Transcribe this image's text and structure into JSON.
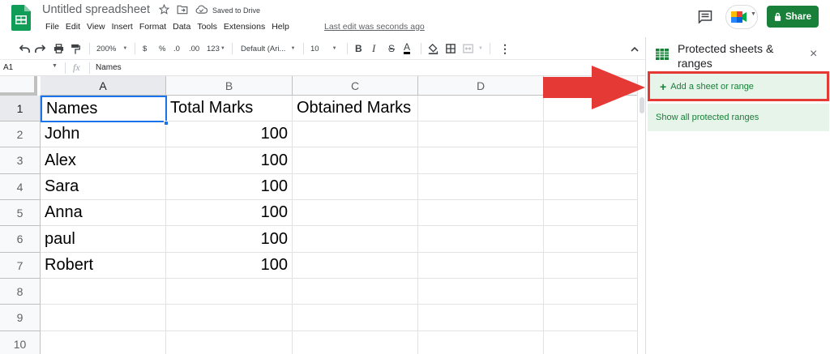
{
  "app": {
    "doc_title": "Untitled spreadsheet",
    "save_status": "Saved to Drive",
    "last_edit": "Last edit was seconds ago",
    "share_label": "Share"
  },
  "menu": [
    "File",
    "Edit",
    "View",
    "Insert",
    "Format",
    "Data",
    "Tools",
    "Extensions",
    "Help"
  ],
  "toolbar": {
    "zoom": "200%",
    "currency": "$",
    "percent": "%",
    "decrease_decimal": ".0",
    "increase_decimal": ".00",
    "more_formats": "123",
    "font": "Default (Ari...",
    "font_size": "10",
    "bold": "B",
    "italic": "I",
    "strike": "S",
    "text_color": "A",
    "more": "⋮"
  },
  "formula_bar": {
    "cell_ref": "A1",
    "fx": "fx",
    "value": "Names"
  },
  "grid": {
    "columns": [
      "A",
      "B",
      "C",
      "D"
    ],
    "rows": [
      "1",
      "2",
      "3",
      "4",
      "5",
      "6",
      "7",
      "8",
      "9",
      "10"
    ],
    "data": [
      [
        "Names",
        "Total Marks",
        "Obtained Marks",
        ""
      ],
      [
        "John",
        "100",
        "",
        ""
      ],
      [
        "Alex",
        "100",
        "",
        ""
      ],
      [
        "Sara",
        "100",
        "",
        ""
      ],
      [
        "Anna",
        "100",
        "",
        ""
      ],
      [
        "paul",
        "100",
        "",
        ""
      ],
      [
        "Robert",
        "100",
        "",
        ""
      ],
      [
        "",
        "",
        "",
        ""
      ],
      [
        "",
        "",
        "",
        ""
      ],
      [
        "",
        "",
        "",
        ""
      ]
    ],
    "active_cell": "A1"
  },
  "panel": {
    "title": "Protected sheets & ranges",
    "add_label": "Add a sheet or range",
    "show_all_label": "Show all protected ranges",
    "close": "×"
  },
  "colors": {
    "share_green": "#188038",
    "panel_highlight": "#e6f4ea",
    "annotation_red": "#e53935",
    "selection_blue": "#1a73e8"
  }
}
